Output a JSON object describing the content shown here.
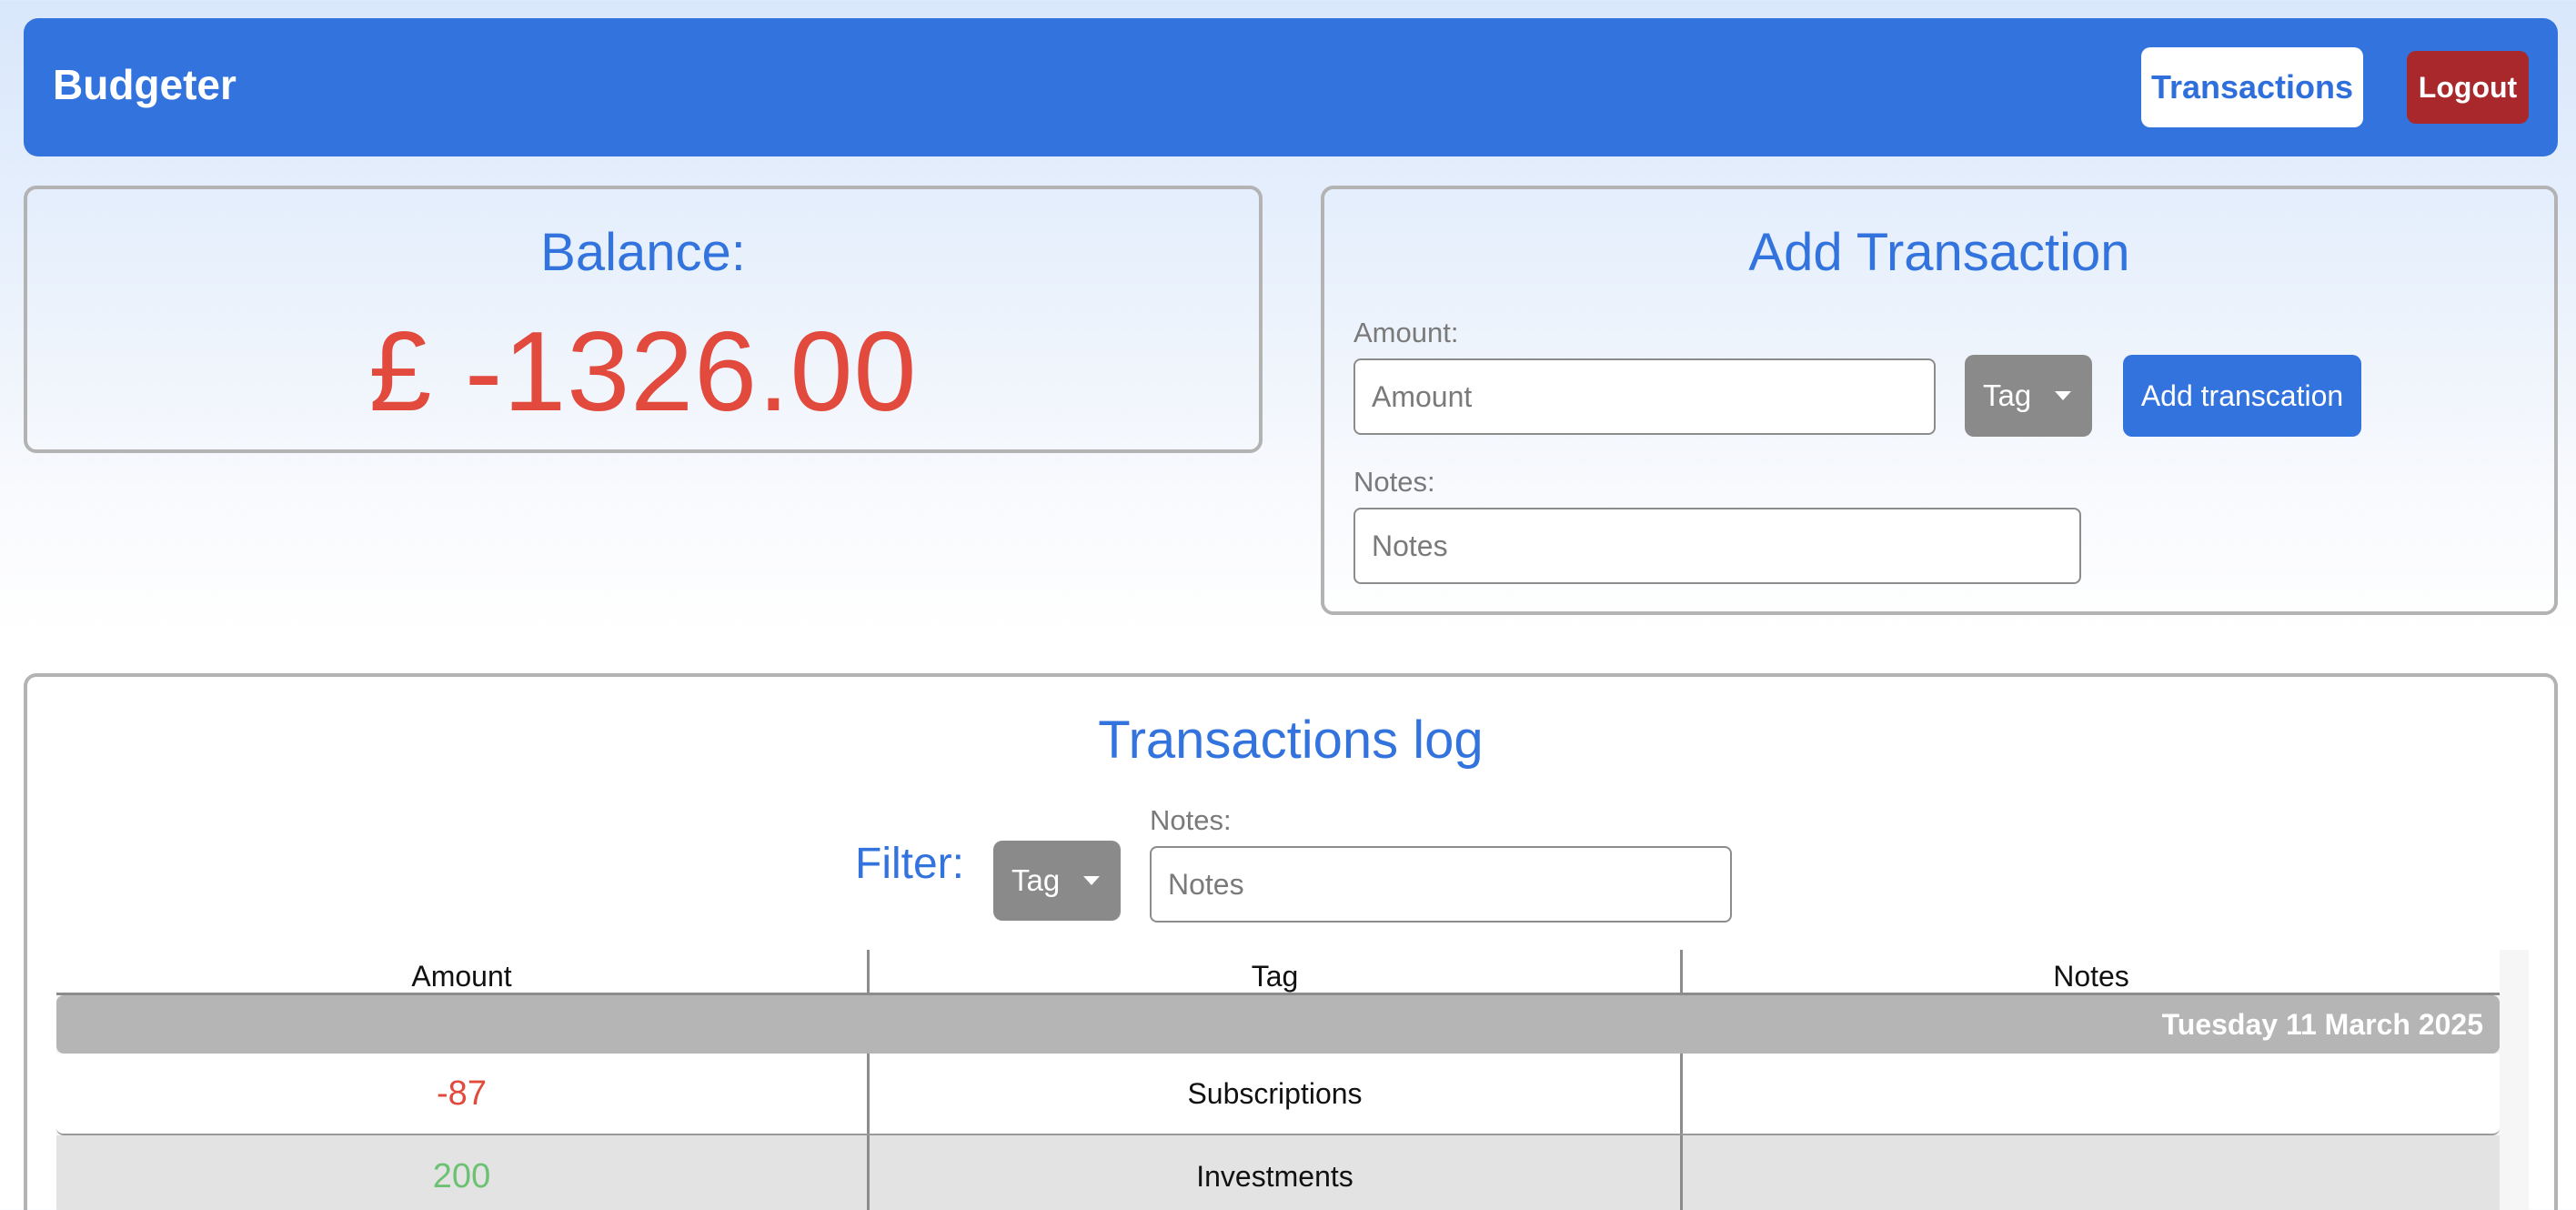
{
  "app": {
    "brand": "Budgeter",
    "nav": {
      "transactions_label": "Transactions",
      "logout_label": "Logout"
    }
  },
  "balance": {
    "title": "Balance:",
    "value": "£ -1326.00"
  },
  "add_transaction": {
    "title": "Add Transaction",
    "amount_label": "Amount:",
    "amount_placeholder": "Amount",
    "amount_value": "",
    "tag_label": "Tag",
    "submit_label": "Add transcation",
    "notes_label": "Notes:",
    "notes_placeholder": "Notes",
    "notes_value": ""
  },
  "transactions_log": {
    "title": "Transactions log",
    "filter_label": "Filter:",
    "filter_tag_label": "Tag",
    "filter_notes_label": "Notes:",
    "filter_notes_placeholder": "Notes",
    "filter_notes_value": "",
    "columns": [
      "Amount",
      "Tag",
      "Notes"
    ],
    "groups": [
      {
        "date": "Tuesday 11 March 2025",
        "rows": [
          {
            "amount": "-87",
            "tag": "Subscriptions",
            "notes": ""
          },
          {
            "amount": "200",
            "tag": "Investments",
            "notes": ""
          }
        ]
      }
    ]
  },
  "colors": {
    "primary": "#3373de",
    "danger": "#a8282c",
    "negative": "#e24a3e",
    "positive": "#6cc173",
    "neutral_button": "#8a8a8a"
  }
}
